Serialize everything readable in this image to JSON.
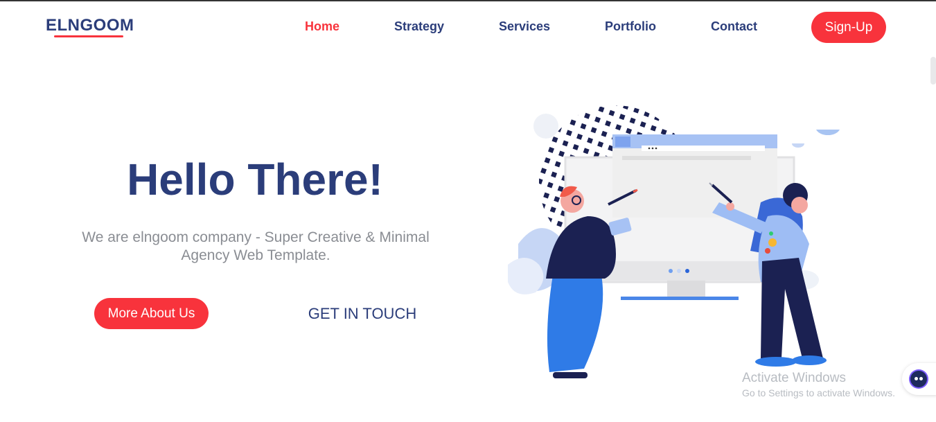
{
  "nav": {
    "logo": "ELNGOOM",
    "links": [
      {
        "label": "Home",
        "active": true
      },
      {
        "label": "Strategy",
        "active": false
      },
      {
        "label": "Services",
        "active": false
      },
      {
        "label": "Portfolio",
        "active": false
      },
      {
        "label": "Contact",
        "active": false
      }
    ],
    "signup_label": "Sign-Up"
  },
  "hero": {
    "title": "Hello There!",
    "subtitle": "We are elngoom company - Super Creative & Minimal Agency Web Template.",
    "primary_button": "More About Us",
    "secondary_button": "GET IN TOUCH"
  },
  "watermark": {
    "title": "Activate Windows",
    "subtitle": "Go to Settings to activate Windows."
  },
  "colors": {
    "brand_navy": "#2b3d7a",
    "accent_red": "#f8333c",
    "muted_text": "#8a8d93"
  },
  "icons": [
    "illustration-people-at-screen",
    "chat-bot-icon"
  ]
}
